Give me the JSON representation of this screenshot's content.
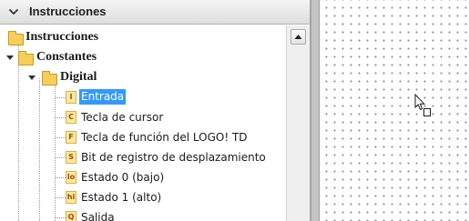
{
  "panel": {
    "header_title": "Instrucciones"
  },
  "tree": {
    "root": "Instrucciones",
    "constantes": "Constantes",
    "digital": "Digital",
    "items": [
      {
        "icon": "I",
        "label": "Entrada",
        "selected": true
      },
      {
        "icon": "C",
        "label": "Tecla de cursor"
      },
      {
        "icon": "F",
        "label": "Tecla de función del LOGO! TD"
      },
      {
        "icon": "S",
        "label": "Bit de registro de desplazamiento"
      },
      {
        "icon": "lo",
        "label": "Estado 0 (bajo)"
      },
      {
        "icon": "hi",
        "label": "Estado 1 (alto)"
      },
      {
        "icon": "Q",
        "label": "Salida"
      }
    ]
  },
  "colors": {
    "selection": "#3399ff",
    "folder": "#f6cf5a",
    "leaf_icon_text": "#9a4a00"
  }
}
